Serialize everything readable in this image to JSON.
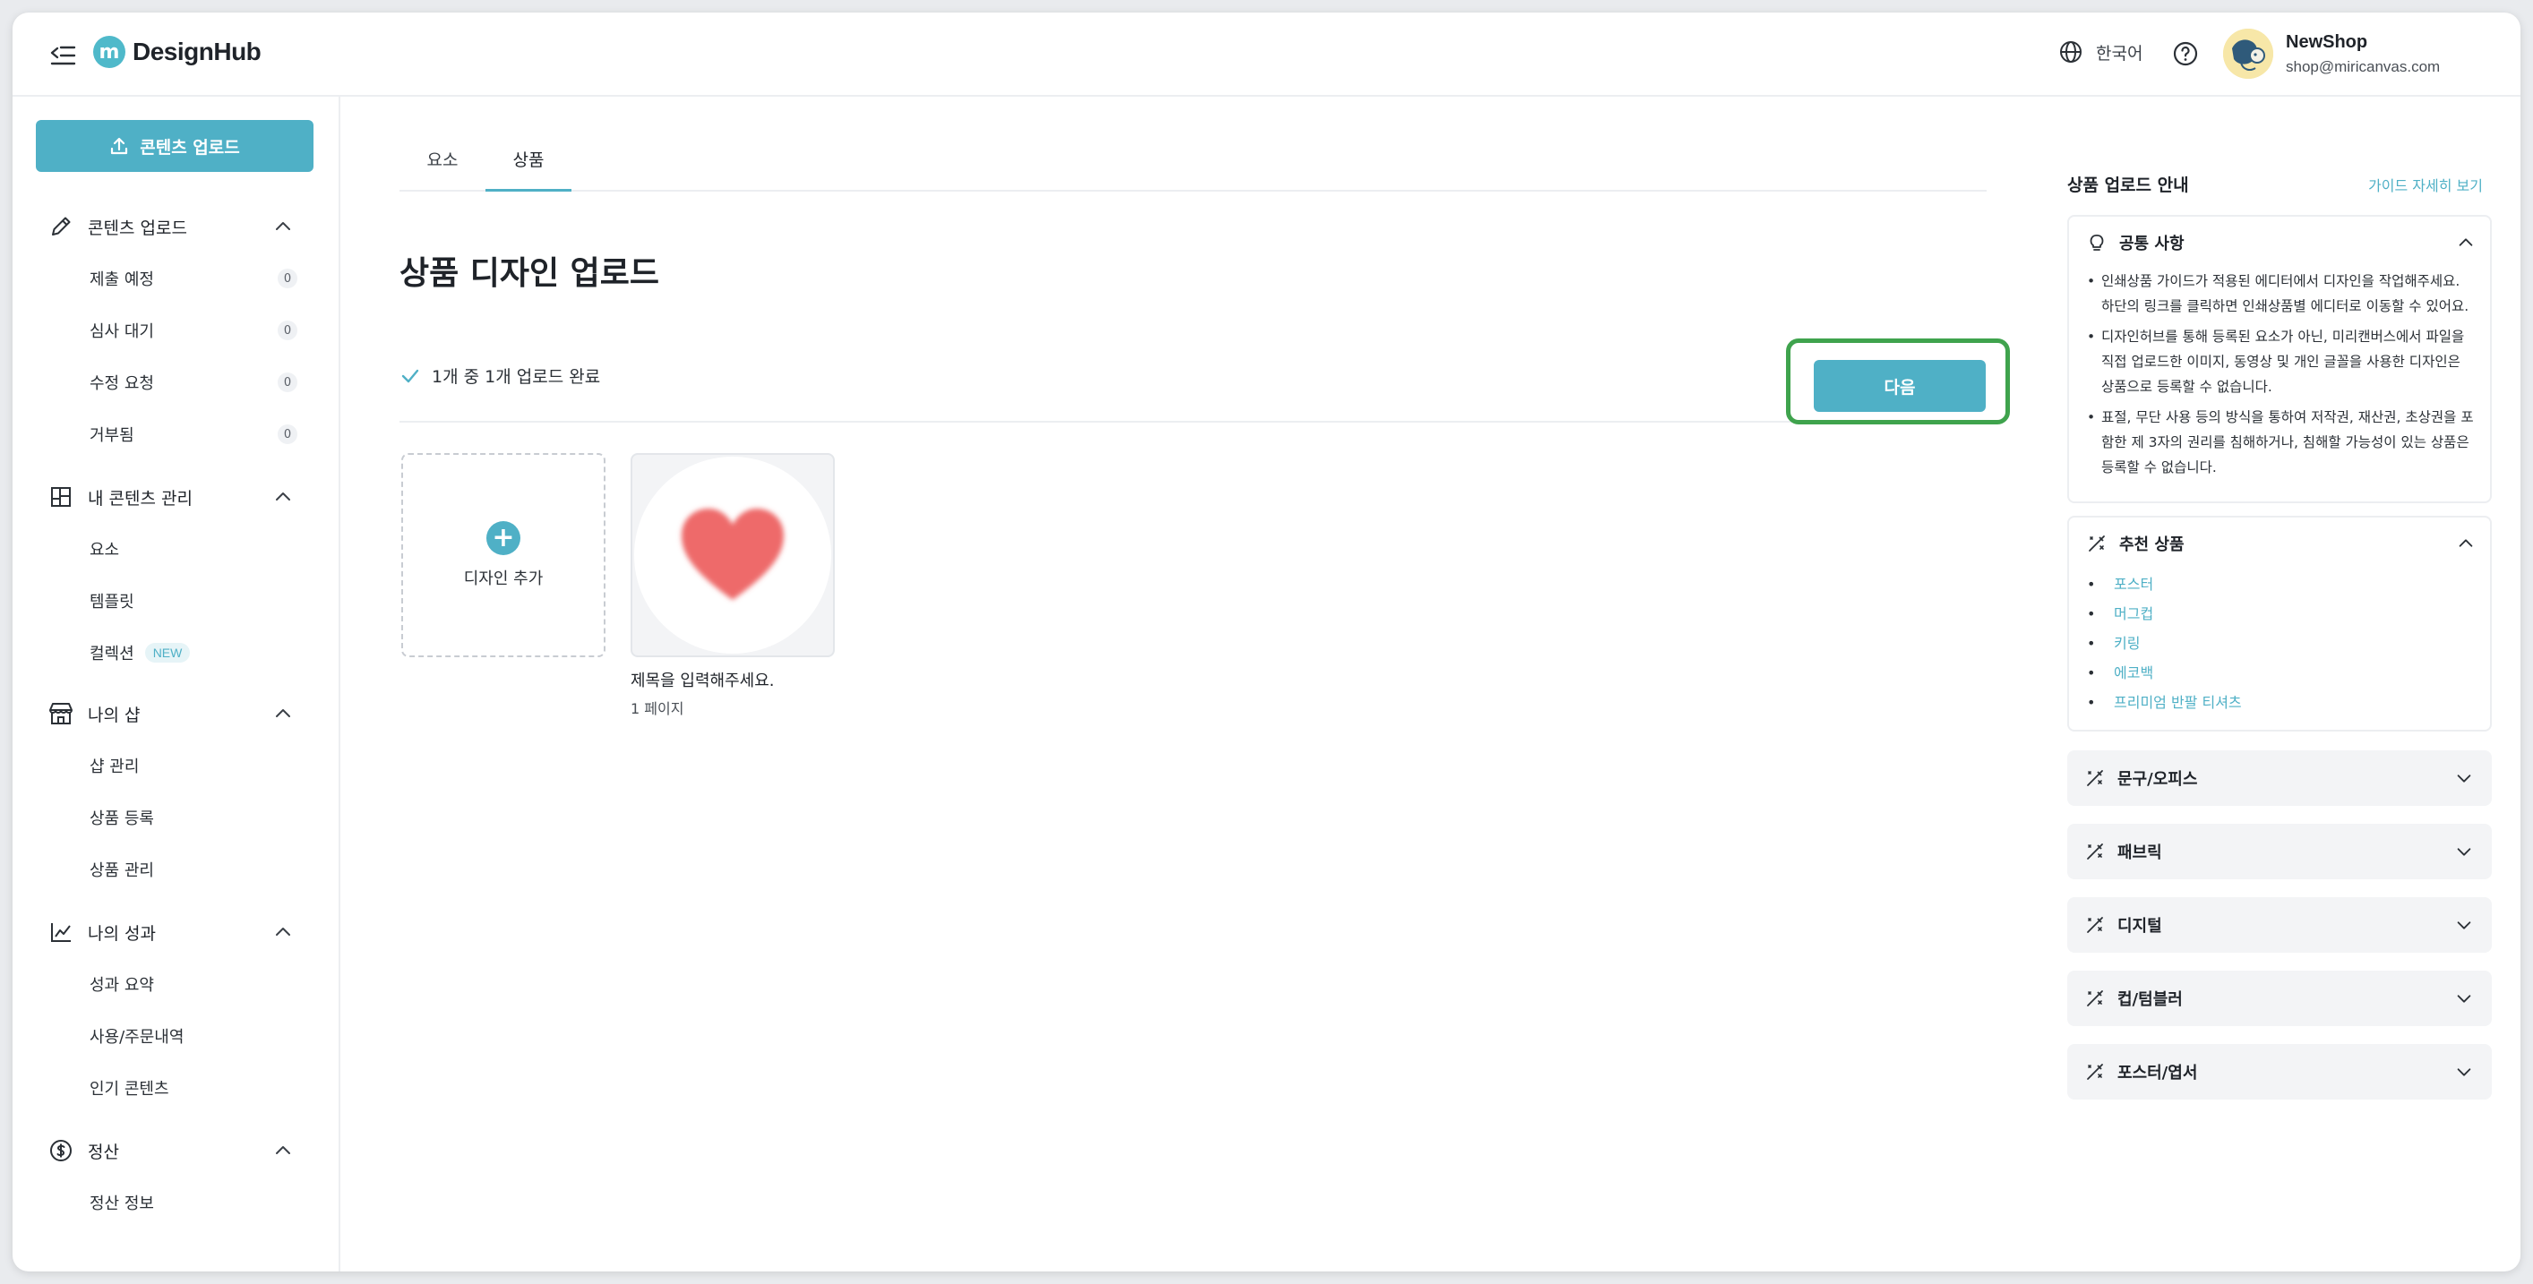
{
  "header": {
    "logo_mark": "m",
    "logo_text": "DesignHub",
    "language": "한국어",
    "user_name": "NewShop",
    "user_email": "shop@miricanvas.com"
  },
  "sidebar": {
    "upload_button": "콘텐츠 업로드",
    "sections": [
      {
        "title": "콘텐츠 업로드",
        "icon": "pencil-icon",
        "items": [
          {
            "label": "제출 예정",
            "count": "0"
          },
          {
            "label": "심사 대기",
            "count": "0"
          },
          {
            "label": "수정 요청",
            "count": "0"
          },
          {
            "label": "거부됨",
            "count": "0"
          }
        ]
      },
      {
        "title": "내 콘텐츠 관리",
        "icon": "layout-icon",
        "items": [
          {
            "label": "요소"
          },
          {
            "label": "템플릿"
          },
          {
            "label": "컬렉션",
            "badge": "NEW"
          }
        ]
      },
      {
        "title": "나의 샵",
        "icon": "store-icon",
        "items": [
          {
            "label": "샵 관리"
          },
          {
            "label": "상품 등록"
          },
          {
            "label": "상품 관리"
          }
        ]
      },
      {
        "title": "나의 성과",
        "icon": "chart-icon",
        "items": [
          {
            "label": "성과 요약"
          },
          {
            "label": "사용/주문내역"
          },
          {
            "label": "인기 콘텐츠"
          }
        ]
      },
      {
        "title": "정산",
        "icon": "dollar-icon",
        "items": [
          {
            "label": "정산 정보"
          }
        ]
      }
    ]
  },
  "main": {
    "tabs": [
      {
        "label": "요소",
        "active": false
      },
      {
        "label": "상품",
        "active": true
      }
    ],
    "title": "상품 디자인 업로드",
    "status": "1개 중 1개 업로드 완료",
    "next_button": "다음",
    "add_design_label": "디자인 추가",
    "design": {
      "title": "제목을 입력해주세요.",
      "pages": "1 페이지"
    }
  },
  "right_panel": {
    "title": "상품 업로드 안내",
    "guide_link": "가이드 자세히 보기",
    "common": {
      "title": "공통 사항",
      "bullets": [
        "인쇄상품 가이드가 적용된 에디터에서 디자인을 작업해주세요. 하단의 링크를 클릭하면 인쇄상품별 에디터로 이동할 수 있어요.",
        "디자인허브를 통해 등록된 요소가 아닌, 미리캔버스에서 파일을 직접 업로드한 이미지, 동영상 및 개인 글꼴을 사용한 디자인은 상품으로 등록할 수 없습니다.",
        "표절, 무단 사용 등의 방식을 통하여 저작권, 재산권, 초상권을 포함한 제 3자의 권리를 침해하거나, 침해할 가능성이 있는 상품은 등록할 수 없습니다."
      ]
    },
    "recommended": {
      "title": "추천 상품",
      "items": [
        "포스터",
        "머그컵",
        "키링",
        "에코백",
        "프리미엄 반팔 티셔츠"
      ]
    },
    "categories": [
      "문구/오피스",
      "패브릭",
      "디지털",
      "컵/텀블러",
      "포스터/엽서"
    ]
  },
  "colors": {
    "accent": "#4fb0c6",
    "highlight_border": "#3fa34d",
    "heart": "#ee6b6b"
  }
}
